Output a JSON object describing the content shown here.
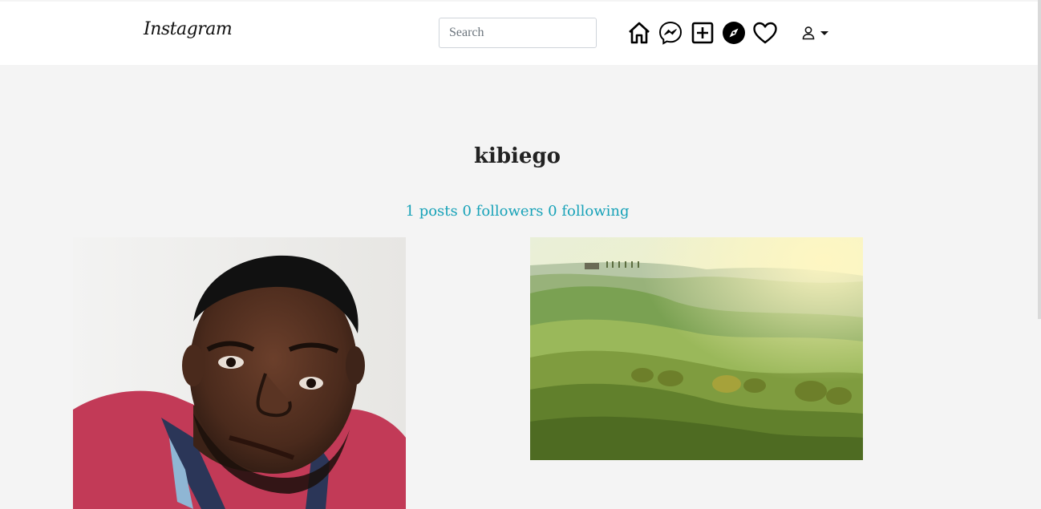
{
  "navbar": {
    "logo_text": "Instagram",
    "search": {
      "placeholder": "Search",
      "value": ""
    },
    "icons": [
      "home-icon",
      "messenger-icon",
      "new-post-icon",
      "explore-icon",
      "activity-heart-icon",
      "user-icon",
      "caret-down-icon"
    ]
  },
  "profile": {
    "username": "kibiego",
    "stats": {
      "posts": "1 posts",
      "followers": "0 followers",
      "following": "0 following"
    }
  },
  "posts": [
    {
      "type": "portrait-photo"
    },
    {
      "type": "landscape-photo"
    }
  ],
  "colors": {
    "accent": "#17a2b8",
    "background": "#f4f4f4",
    "navbar": "#ffffff"
  }
}
